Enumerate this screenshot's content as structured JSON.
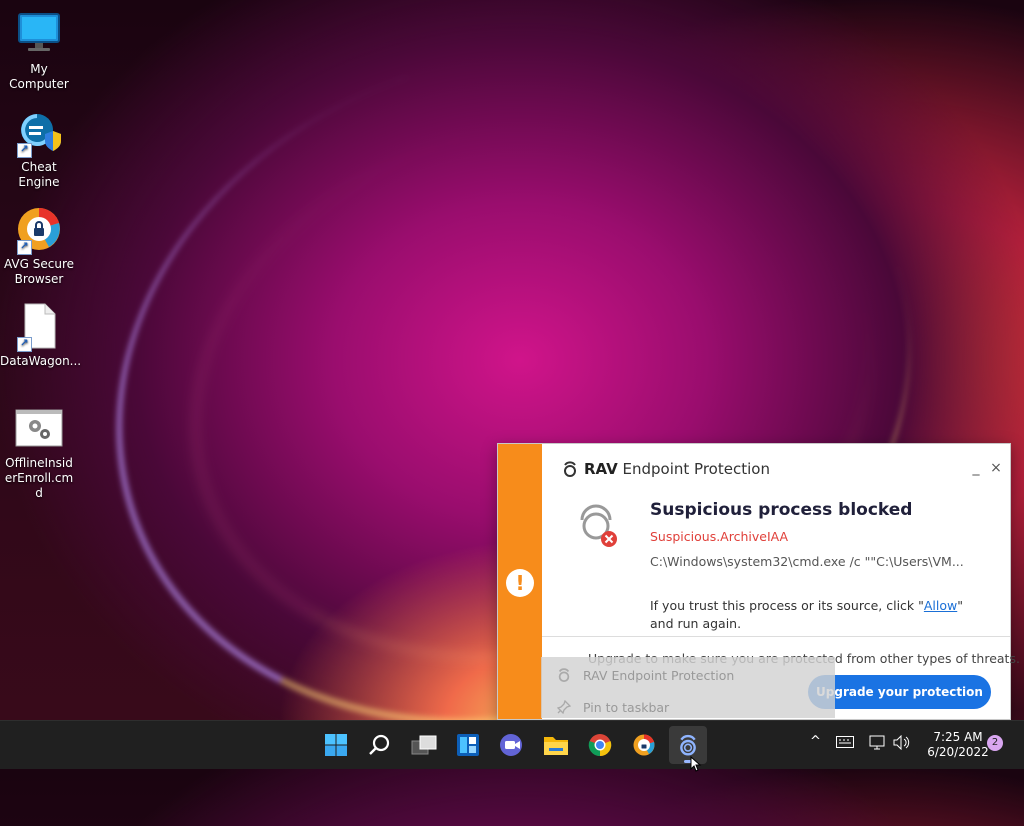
{
  "desktop": {
    "icons": [
      {
        "label": "My Computer",
        "icon": "monitor-icon"
      },
      {
        "label": "Cheat Engine",
        "icon": "cheat-engine-icon"
      },
      {
        "label": "AVG Secure Browser",
        "icon": "avg-browser-icon"
      },
      {
        "label": "DataWagon...",
        "icon": "blank-file-icon"
      },
      {
        "label": "OfflineInsiderEnroll.cmd",
        "icon": "cmd-script-icon"
      }
    ]
  },
  "popup": {
    "brand_strong": "RAV",
    "brand_rest": "Endpoint Protection",
    "minimize": "_",
    "close": "×",
    "badge": "!",
    "headline": "Suspicious process blocked",
    "threat_name": "Suspicious.ArchiveIAA",
    "command_path": "C:\\Windows\\system32\\cmd.exe /c \"\"C:\\Users\\VM...",
    "trust_prefix": "If you trust this process or its source, click \"",
    "trust_link": "Allow",
    "trust_suffix": "\" and run again.",
    "upsell": "Upgrade to make sure you are protected from other types of threats.",
    "upgrade_button": "Upgrade your protection",
    "colors": {
      "stripe": "#f78c1b",
      "threat": "#e0403a",
      "button": "#1a73e3"
    }
  },
  "jumplist": {
    "items": [
      {
        "label": "RAV Endpoint Protection",
        "icon": "rav-icon"
      },
      {
        "label": "Pin to taskbar",
        "icon": "pin-icon"
      }
    ]
  },
  "taskbar": {
    "apps": [
      {
        "name": "start",
        "icon": "windows-start-icon"
      },
      {
        "name": "search",
        "icon": "search-icon"
      },
      {
        "name": "task-view",
        "icon": "task-view-icon"
      },
      {
        "name": "widgets",
        "icon": "widgets-icon"
      },
      {
        "name": "chat",
        "icon": "teams-chat-icon"
      },
      {
        "name": "file-explorer",
        "icon": "folder-icon"
      },
      {
        "name": "chrome",
        "icon": "chrome-icon"
      },
      {
        "name": "avg-browser",
        "icon": "avg-browser-icon"
      },
      {
        "name": "rav",
        "icon": "rav-icon"
      }
    ],
    "tray": {
      "chevron": "^",
      "time": "7:25 AM",
      "date": "6/20/2022",
      "notifications": "2"
    }
  }
}
